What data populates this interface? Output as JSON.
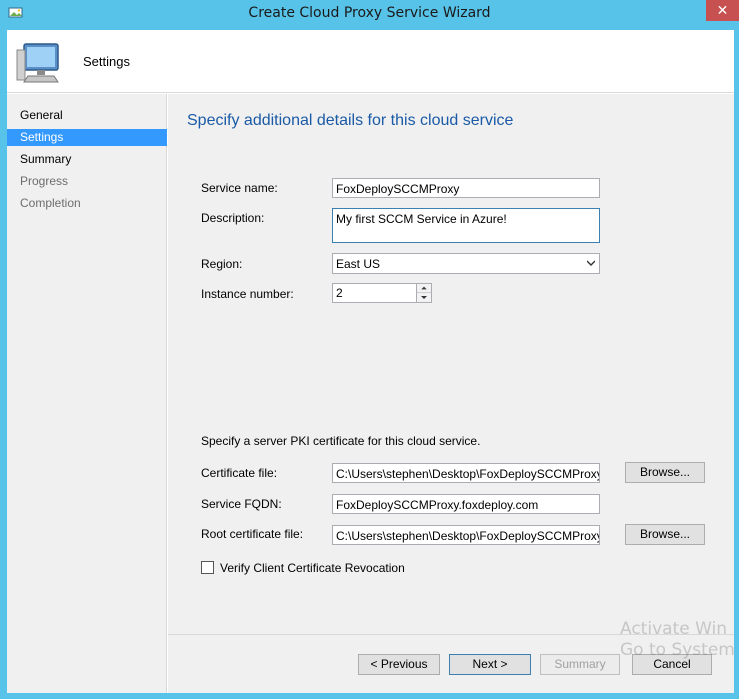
{
  "window": {
    "title": "Create Cloud Proxy Service Wizard",
    "close_label": "✕"
  },
  "header": {
    "title": "Settings"
  },
  "sidebar": {
    "items": [
      {
        "label": "General",
        "state": "normal"
      },
      {
        "label": "Settings",
        "state": "active"
      },
      {
        "label": "Summary",
        "state": "normal"
      },
      {
        "label": "Progress",
        "state": "disabled"
      },
      {
        "label": "Completion",
        "state": "disabled"
      }
    ]
  },
  "main": {
    "heading": "Specify additional details for this cloud service",
    "service_name": {
      "label": "Service name:",
      "value": "FoxDeploySCCMProxy"
    },
    "description": {
      "label": "Description:",
      "value": "My first SCCM Service in Azure!"
    },
    "region": {
      "label": "Region:",
      "value": "East US"
    },
    "instance_number": {
      "label": "Instance number:",
      "value": "2"
    },
    "pki_text": "Specify a server PKI certificate for this cloud service.",
    "certificate_file": {
      "label": "Certificate file:",
      "value": "C:\\Users\\stephen\\Desktop\\FoxDeploySCCMProxy.pfx",
      "browse_label": "Browse..."
    },
    "service_fqdn": {
      "label": "Service FQDN:",
      "value": "FoxDeploySCCMProxy.foxdeploy.com"
    },
    "root_certificate_file": {
      "label": "Root certificate file:",
      "value": "C:\\Users\\stephen\\Desktop\\FoxDeploySCCMProxy.cer",
      "browse_label": "Browse..."
    },
    "verify_revocation": {
      "label": "Verify Client Certificate Revocation",
      "checked": false
    }
  },
  "footer": {
    "previous_label": "< Previous",
    "next_label": "Next >",
    "summary_label": "Summary",
    "cancel_label": "Cancel"
  },
  "watermark": {
    "line1": "Activate Win",
    "line2": "Go to System in"
  },
  "colors": {
    "titlebar": "#58c3e8",
    "accent_selection": "#3399ff",
    "heading": "#1a5aa6",
    "close": "#c75050"
  }
}
